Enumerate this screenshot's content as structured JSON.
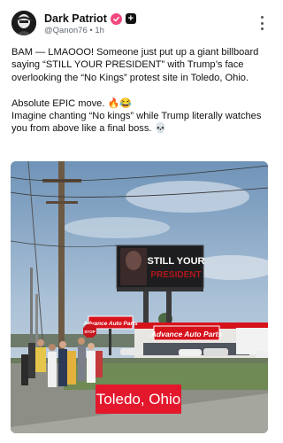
{
  "post": {
    "author_name": "Dark Patriot",
    "handle": "@Qanon76",
    "separator": "•",
    "time": "1h",
    "plus_glyph": "+",
    "paragraphs": [
      "BAM — LMAOOO! Someone just put up a giant billboard saying “STILL YOUR PRESIDENT” with Trump’s face overlooking the “No Kings” protest site in Toledo, Ohio.",
      "Absolute EPIC move. 🔥😂",
      "Imagine chanting “No kings” while Trump literally watches you from above like a final boss. 💀"
    ]
  },
  "media": {
    "billboard_line1": "STILL YOUR",
    "billboard_line2": "PRESIDENT",
    "store_sign": "Advance Auto Parts",
    "small_sign": "Advance Auto Parts",
    "stop_sign": "STOP",
    "caption": "Toledo, Ohio"
  },
  "colors": {
    "verified_badge": "#f0487f",
    "caption_bg": "#e3182d",
    "store_red": "#d6121b"
  },
  "icons": {
    "verified": "verified-check-icon",
    "plus": "plus-badge-icon",
    "menu": "more-options-icon"
  }
}
